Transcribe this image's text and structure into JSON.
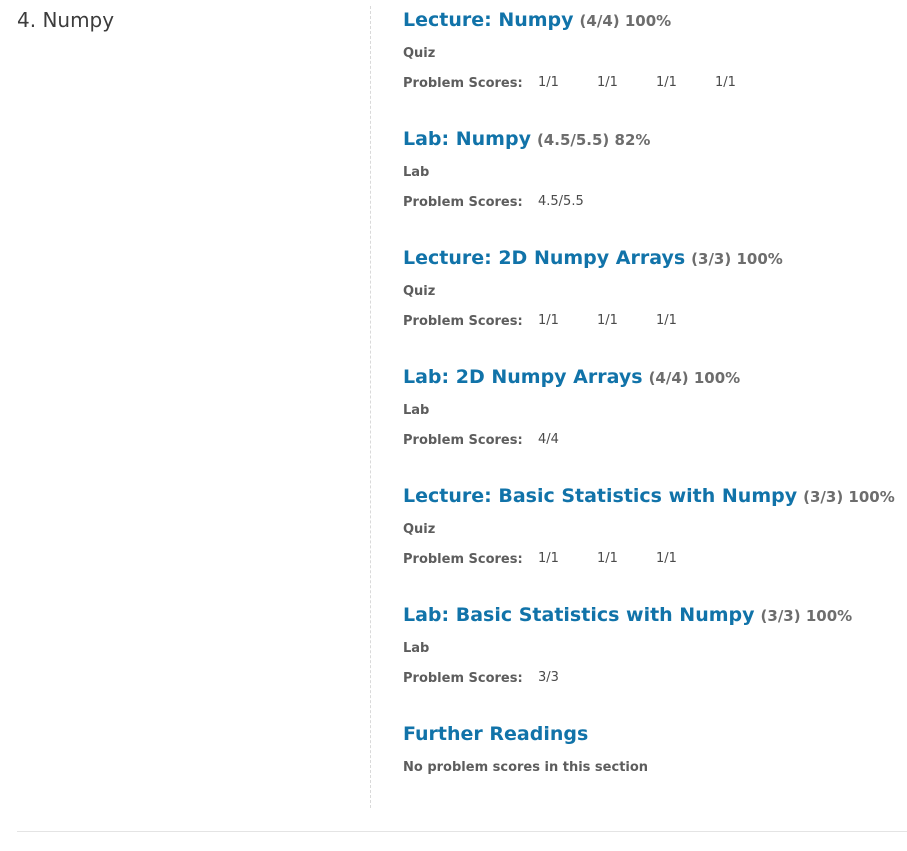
{
  "chapter": {
    "title": "4. Numpy"
  },
  "problem_scores_label": "Problem Scores:",
  "sections": [
    {
      "title": "Lecture: Numpy",
      "score": "(4/4) 100%",
      "type": "Quiz",
      "problem_scores": [
        "1/1",
        "1/1",
        "1/1",
        "1/1"
      ]
    },
    {
      "title": "Lab: Numpy",
      "score": "(4.5/5.5) 82%",
      "type": "Lab",
      "problem_scores": [
        "4.5/5.5"
      ]
    },
    {
      "title": "Lecture: 2D Numpy Arrays",
      "score": "(3/3) 100%",
      "type": "Quiz",
      "problem_scores": [
        "1/1",
        "1/1",
        "1/1"
      ]
    },
    {
      "title": "Lab: 2D Numpy Arrays",
      "score": "(4/4) 100%",
      "type": "Lab",
      "problem_scores": [
        "4/4"
      ]
    },
    {
      "title": "Lecture: Basic Statistics with Numpy",
      "score": "(3/3) 100%",
      "type": "Quiz",
      "problem_scores": [
        "1/1",
        "1/1",
        "1/1"
      ]
    },
    {
      "title": "Lab: Basic Statistics with Numpy",
      "score": "(3/3) 100%",
      "type": "Lab",
      "problem_scores": [
        "3/3"
      ]
    }
  ],
  "further_readings": {
    "title": "Further Readings",
    "message": "No problem scores in this section"
  },
  "colors": {
    "link": "#1173a9",
    "text": "#3c3c3c",
    "muted": "#6d6d6d"
  }
}
